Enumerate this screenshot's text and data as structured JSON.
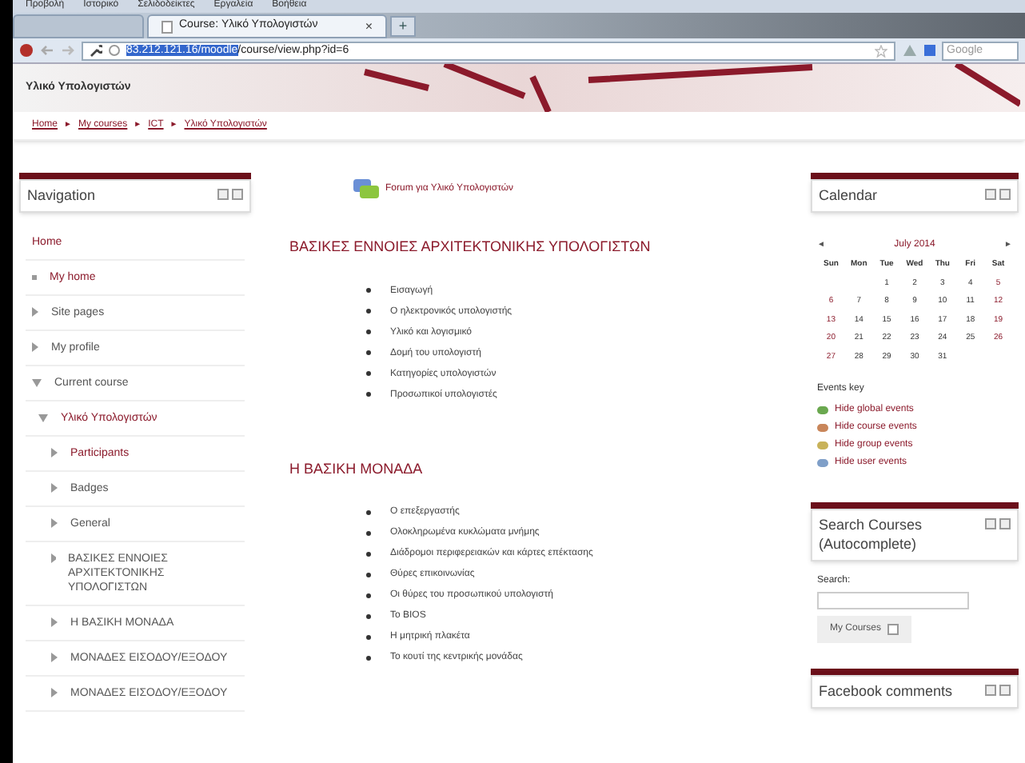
{
  "menu_bar": [
    "Προβολή",
    "Ιστορικό",
    "Σελιδοδείκτες",
    "Εργαλεία",
    "Βοήθεια"
  ],
  "tabs": [
    {
      "selected": false
    },
    {
      "label": "Course: Υλικό Υπολογιστών",
      "selected": true,
      "close": "×"
    }
  ],
  "new_tab": "+",
  "address_bar": {
    "url_selected": "83.212.121.16/moodle",
    "url_rest": "/course/view.php?id=6"
  },
  "search_engine": {
    "placeholder": "Google"
  },
  "site_title": "Υλικό Υπολογιστών",
  "breadcrumb": [
    "Home",
    "My courses",
    "ICT",
    "Υλικό Υπολογιστών"
  ],
  "breadcrumb_separator": "►",
  "navigation": {
    "title": "Navigation",
    "items": [
      {
        "label": "Home",
        "kind": "plain",
        "link": true
      },
      {
        "label": "My home",
        "kind": "leaf",
        "link": true
      },
      {
        "label": "Site pages",
        "kind": "branch",
        "expanded": false,
        "link": false
      },
      {
        "label": "My profile",
        "kind": "branch",
        "expanded": false,
        "link": false
      },
      {
        "label": "Current course",
        "kind": "branch",
        "expanded": true,
        "link": false,
        "children": [
          {
            "label": "Υλικό Υπολογιστών",
            "kind": "branch",
            "expanded": true,
            "link": true,
            "children": [
              {
                "label": "Participants",
                "kind": "branch",
                "expanded": false,
                "link": true
              },
              {
                "label": "Badges",
                "kind": "branch",
                "expanded": false,
                "link": false
              },
              {
                "label": "General",
                "kind": "branch",
                "expanded": false,
                "link": false
              },
              {
                "label": "ΒΑΣΙΚΕΣ ΕΝΝΟΙΕΣ ΑΡΧΙΤΕΚΤΟΝΙΚΗΣ ΥΠΟΛΟΓΙΣΤΩΝ",
                "kind": "branch",
                "expanded": false,
                "link": false
              },
              {
                "label": "Η ΒΑΣΙΚΗ ΜΟΝΑΔΑ",
                "kind": "branch",
                "expanded": false,
                "link": false
              },
              {
                "label": "ΜΟΝΑΔΕΣ ΕΙΣΟΔΟΥ/ΕΞΟΔΟΥ",
                "kind": "branch",
                "expanded": false,
                "link": false
              },
              {
                "label": "ΜΟΝΑΔΕΣ ΕΙΣΟΔΟΥ/ΕΞΟΔΟΥ",
                "kind": "branch",
                "expanded": false,
                "link": false
              }
            ]
          }
        ]
      }
    ]
  },
  "forum": "Forum για Υλικό Υπολογιστών",
  "sections": [
    {
      "title": "ΒΑΣΙΚΕΣ ΕΝΝΟΙΕΣ ΑΡΧΙΤΕΚΤΟΝΙΚΗΣ ΥΠΟΛΟΓΙΣΤΩΝ",
      "items": [
        "Εισαγωγή",
        "Ο ηλεκτρονικός υπολογιστής",
        "Υλικό και λογισμικό",
        "Δομή του υπολογιστή",
        "Κατηγορίες υπολογιστών",
        "Προσωπικοί υπολογιστές"
      ]
    },
    {
      "title": "Η ΒΑΣΙΚΗ ΜΟΝΑΔΑ",
      "items": [
        "Ο επεξεργαστής",
        "Ολοκληρωμένα κυκλώματα μνήμης",
        "Διάδρομοι περιφερειακών και κάρτες επέκτασης",
        "Θύρες επικοινωνίας",
        "Οι θύρες του προσωπικού υπολογιστή",
        "Το BIOS",
        "Η μητρική πλακέτα",
        "Το κουτί της κεντρικής μονάδας"
      ]
    }
  ],
  "calendar": {
    "title": "Calendar",
    "prev": "◄",
    "next": "►",
    "month": "July 2014",
    "weekdays": [
      "Sun",
      "Mon",
      "Tue",
      "Wed",
      "Thu",
      "Fri",
      "Sat"
    ],
    "weeks": [
      [
        "1",
        "2",
        "3",
        "4",
        "5"
      ],
      [
        "6",
        "7",
        "8",
        "9",
        "10",
        "11",
        "12"
      ],
      [
        "13",
        "14",
        "15",
        "16",
        "17",
        "18",
        "19"
      ],
      [
        "20",
        "21",
        "22",
        "23",
        "24",
        "25",
        "26"
      ],
      [
        "27",
        "28",
        "29",
        "30",
        "31"
      ]
    ],
    "events_key": "Events key",
    "events": [
      {
        "label": "Hide global events",
        "color": "#6aa84f"
      },
      {
        "label": "Hide course events",
        "color": "#c9865a"
      },
      {
        "label": "Hide group events",
        "color": "#c8b25a"
      },
      {
        "label": "Hide user events",
        "color": "#7f9fc8"
      }
    ]
  },
  "search_courses": {
    "title": "Search Courses (Autocomplete)",
    "label": "Search:",
    "button": "My Courses",
    "checked": false
  },
  "facebook": {
    "title": "Facebook comments"
  }
}
